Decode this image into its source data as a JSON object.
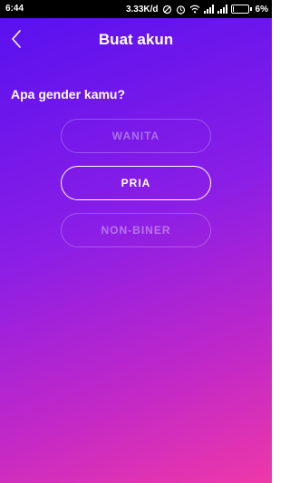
{
  "status_bar": {
    "time": "6:44",
    "network_speed": "3.33K/d",
    "battery_percent": "6%",
    "battery_level": 0.06
  },
  "header": {
    "title": "Buat akun",
    "back_icon": "chevron-left-icon"
  },
  "question": "Apa gender kamu?",
  "options": [
    {
      "label": "WANITA",
      "selected": false
    },
    {
      "label": "PRIA",
      "selected": true
    },
    {
      "label": "NON-BINER",
      "selected": false
    }
  ],
  "colors": {
    "gradient_start": "#5510f0",
    "gradient_end": "#ee38a8"
  }
}
